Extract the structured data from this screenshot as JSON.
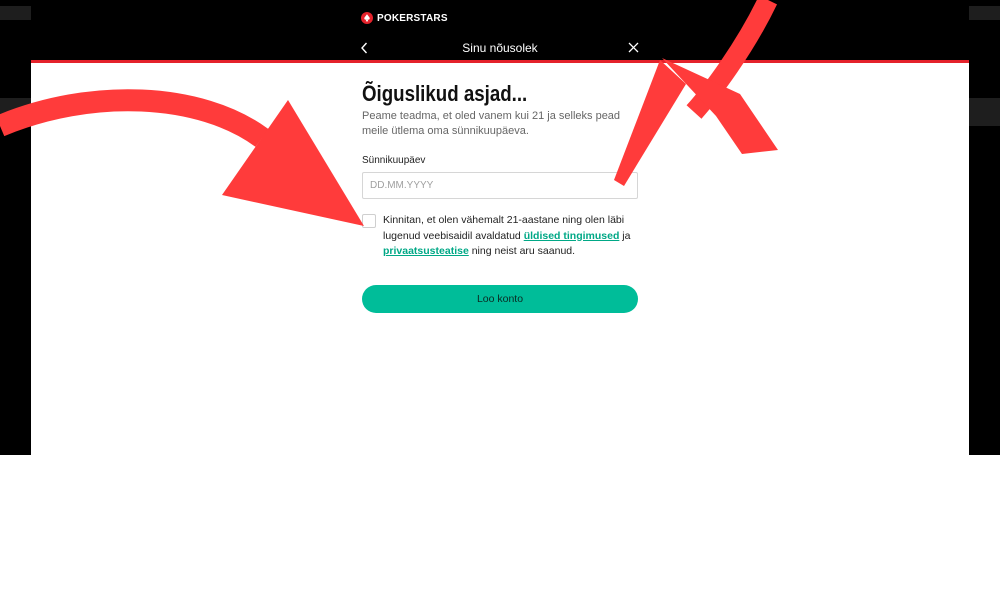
{
  "header": {
    "brand": "POKERSTARS",
    "title": "Sinu nõusolek"
  },
  "main": {
    "title": "Õiguslikud asjad...",
    "subtitle": "Peame teadma, et oled vanem kui 21 ja selleks pead meile ütlema oma sünnikuupäeva.",
    "dob": {
      "label": "Sünnikuupäev",
      "placeholder": "DD.MM.YYYY",
      "value": ""
    },
    "consent": {
      "checked": false,
      "text_before": "Kinnitan, et olen vähemalt 21-aastane ning olen läbi lugenud veebisaidil avaldatud ",
      "link1": "üldised tingimused",
      "text_middle": " ja ",
      "link2": "privaatsusteatise",
      "text_after": " ning neist aru saanud."
    },
    "cta_label": "Loo konto"
  },
  "colors": {
    "brand_red": "#e4222b",
    "accent_green": "#00bd99",
    "link_green": "#00a886",
    "annotation_arrow": "#ff3b3b"
  }
}
